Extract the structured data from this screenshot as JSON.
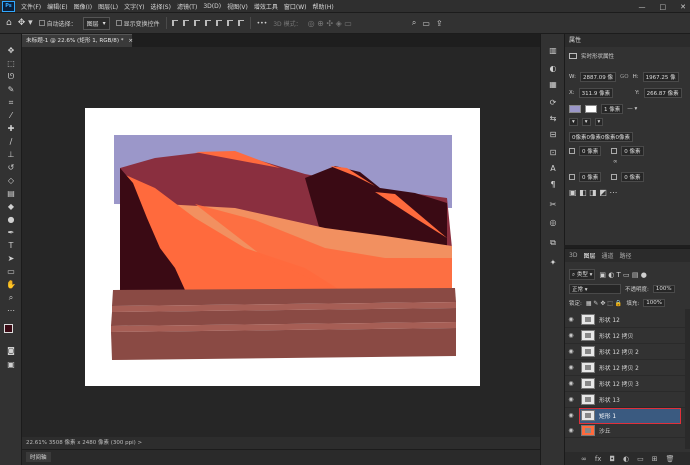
{
  "menubar": {
    "logo": "Ps",
    "items": [
      "文件(F)",
      "编辑(E)",
      "图像(I)",
      "图层(L)",
      "文字(Y)",
      "选择(S)",
      "滤镜(T)",
      "3D(D)",
      "视图(V)",
      "增效工具",
      "窗口(W)",
      "帮助(H)"
    ],
    "window_controls": [
      "—",
      "□",
      "✕"
    ]
  },
  "options": {
    "auto_select_label": "自动选择：",
    "auto_select_value": "图层",
    "show_transform_label": "显示变换控件",
    "more": "•••",
    "mode_3d": "3D 模式："
  },
  "document": {
    "tab_title": "未标题-1 @ 22.6% (矩形 1, RGB/8) *",
    "close": "×"
  },
  "status": {
    "text": "22.61%   3508 像素 x 2480 像素 (300 ppi)   >"
  },
  "timeline": {
    "label": "时间轴"
  },
  "properties": {
    "title": "属性",
    "kind_label": "实时形状属性",
    "w_label": "W:",
    "w_value": "2887.09 像",
    "go_label": "GO",
    "h_label": "H:",
    "h_value": "1967.25 像",
    "x_label": "X:",
    "x_value": "311.9 像素",
    "y_label": "Y:",
    "y_value": "266.87 像素",
    "stroke_width": "1 像素",
    "corners": "0像素0像素0像素0像素",
    "corner_tl": "0 像素",
    "corner_tr": "0 像素",
    "corner_bl": "0 像素",
    "corner_br": "0 像素"
  },
  "layers_panel": {
    "tabs": [
      "3D",
      "图层",
      "通道",
      "路径"
    ],
    "filter_label": "类型",
    "blend_mode": "正常",
    "opacity_label": "不透明度:",
    "opacity_value": "100%",
    "lock_label": "锁定:",
    "fill_label": "填充:",
    "fill_value": "100%",
    "layers": [
      {
        "name": "形状 12",
        "selected": false
      },
      {
        "name": "形状 12 拷贝",
        "selected": false
      },
      {
        "name": "形状 12 拷贝 2",
        "selected": false
      },
      {
        "name": "形状 12 拷贝 2",
        "selected": false
      },
      {
        "name": "形状 12 拷贝 3",
        "selected": false
      },
      {
        "name": "形状 13",
        "selected": false
      },
      {
        "name": "矩形 1",
        "selected": true
      },
      {
        "name": "沙丘",
        "selected": false
      }
    ],
    "footer_icons": [
      "link-icon",
      "fx-icon",
      "mask-icon",
      "adjustment-icon",
      "folder-icon",
      "new-layer-icon",
      "trash-icon"
    ]
  },
  "colors": {
    "accent_selected": "#3a5a80",
    "highlight_box": "#e0303a",
    "sky": "#9b97c9",
    "dune_dark": "#8a2f3f",
    "dune_shadow": "#3a0a14",
    "dune_orange": "#ff6a3d",
    "dune_light": "#f29060",
    "ground": "#8a4a44"
  }
}
